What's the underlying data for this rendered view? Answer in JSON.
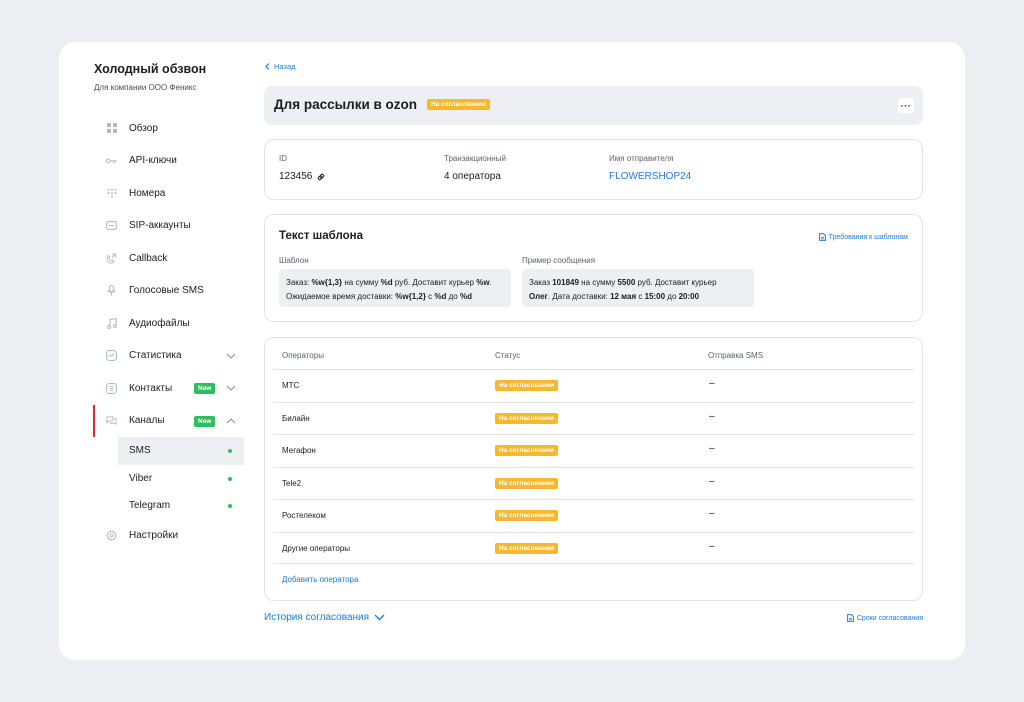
{
  "sidebar": {
    "title": "Холодный обзвон",
    "subtitle": "Для компании ООО Феникс",
    "items": [
      {
        "label": "Обзор",
        "icon": "grid-icon"
      },
      {
        "label": "API-ключи",
        "icon": "key-icon"
      },
      {
        "label": "Номера",
        "icon": "keypad-icon"
      },
      {
        "label": "SIP-аккаунты",
        "icon": "sip-icon"
      },
      {
        "label": "Callback",
        "icon": "callback-icon"
      },
      {
        "label": "Голосовые SMS",
        "icon": "microphone-icon"
      },
      {
        "label": "Аудиофайлы",
        "icon": "music-note-icon"
      },
      {
        "label": "Статистика",
        "icon": "chart-icon"
      },
      {
        "label": "Контакты",
        "icon": "contacts-icon",
        "badge": "New"
      },
      {
        "label": "Каналы",
        "icon": "chat-icon",
        "badge": "New"
      },
      {
        "label": "Настройки",
        "icon": "gear-icon"
      }
    ],
    "channels": [
      {
        "label": "SMS",
        "selected": true
      },
      {
        "label": "Viber"
      },
      {
        "label": "Telegram"
      }
    ]
  },
  "main": {
    "back_label": "Назад",
    "title": "Для рассылки в ozon",
    "title_status": "На согласовании",
    "info": {
      "id_label": "ID",
      "id_value": "123456",
      "type_label": "Транзакционный",
      "type_value": "4 оператора",
      "sender_label": "Имя отправителя",
      "sender_value": "FLOWERSHOP24"
    },
    "template": {
      "title": "Текст шаблона",
      "requirements_link": "Требования к шаблонам",
      "template_label": "Шаблон",
      "example_label": "Пример сообщения",
      "template_line1": [
        "Заказ: ",
        "%w{1,3}",
        " на сумму ",
        "%d",
        " руб. Доставит курьер ",
        "%w",
        "."
      ],
      "template_line2": [
        "Ожидаемое время доставки: ",
        "%w{1,2}",
        " с ",
        "%d",
        " до ",
        "%d"
      ],
      "example_line1": [
        "Заказ ",
        "101849",
        " на сумму ",
        "5500",
        " руб. Доставит курьер"
      ],
      "example_line2": [
        "Олег",
        ". Дата доставки: ",
        "12 мая",
        " с ",
        "15:00",
        " до ",
        "20:00"
      ]
    },
    "operators": {
      "columns": [
        "Операторы",
        "Статус",
        "Отправка SMS"
      ],
      "rows": [
        {
          "name": "МТС",
          "status": "На согласовании",
          "sms": "–"
        },
        {
          "name": "Билайн",
          "status": "На согласовании",
          "sms": "–"
        },
        {
          "name": "Мегафон",
          "status": "На согласовании",
          "sms": "–"
        },
        {
          "name": "Tele2",
          "status": "На согласовании",
          "sms": "–"
        },
        {
          "name": "Ростелеком",
          "status": "На согласовании",
          "sms": "–"
        },
        {
          "name": "Другие операторы",
          "status": "На согласовании",
          "sms": "–"
        }
      ],
      "add_label": "Добавить оператора"
    },
    "history_label": "История согласования",
    "deadlines_label": "Сроки согласования"
  },
  "colors": {
    "accent": "#1e7be0",
    "status_pending": "#f5b82e",
    "badge_new": "#2ebd5f",
    "active_marker": "#e0282e"
  }
}
